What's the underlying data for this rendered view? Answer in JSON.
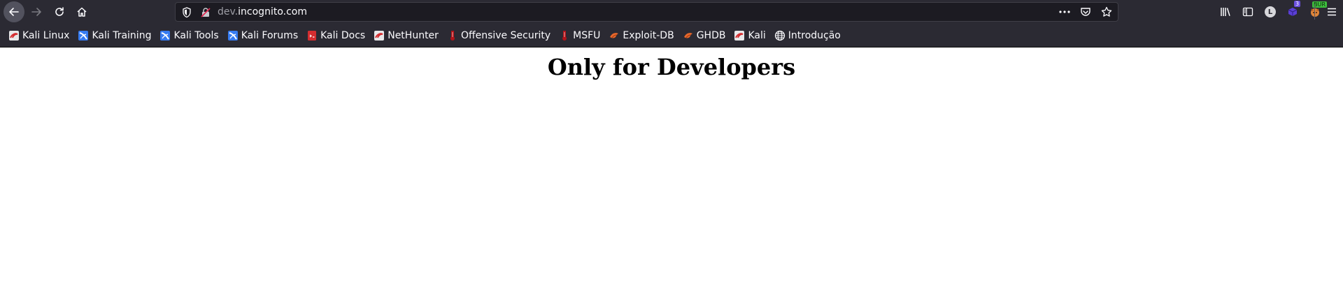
{
  "browser": {
    "url_subdomain": "dev.",
    "url_domain": "incognito.com",
    "extension_badge_count": "3",
    "burp_badge": "BUR",
    "account_initial": "L"
  },
  "bookmarks": [
    {
      "label": "Kali Linux",
      "icon": "kali-dragon-icon"
    },
    {
      "label": "Kali Training",
      "icon": "kali-training-icon"
    },
    {
      "label": "Kali Tools",
      "icon": "kali-tools-icon"
    },
    {
      "label": "Kali Forums",
      "icon": "kali-forums-icon"
    },
    {
      "label": "Kali Docs",
      "icon": "kali-docs-icon"
    },
    {
      "label": "NetHunter",
      "icon": "kali-dragon-icon"
    },
    {
      "label": "Offensive Security",
      "icon": "offsec-icon"
    },
    {
      "label": "MSFU",
      "icon": "offsec-icon"
    },
    {
      "label": "Exploit-DB",
      "icon": "exploit-db-icon"
    },
    {
      "label": "GHDB",
      "icon": "exploit-db-icon"
    },
    {
      "label": "Kali",
      "icon": "kali-dragon-icon"
    },
    {
      "label": "Introdução",
      "icon": "globe-icon"
    }
  ],
  "page": {
    "heading": "Only for Developers"
  },
  "colors": {
    "toolbar_bg": "#2b2a33",
    "urlbar_bg": "#1c1b22",
    "text_light": "#fbfbfe",
    "kali_red": "#d42d30",
    "kali_blue": "#367bf0",
    "offsec_red": "#b0141a",
    "exploitdb_orange": "#e8682c"
  }
}
